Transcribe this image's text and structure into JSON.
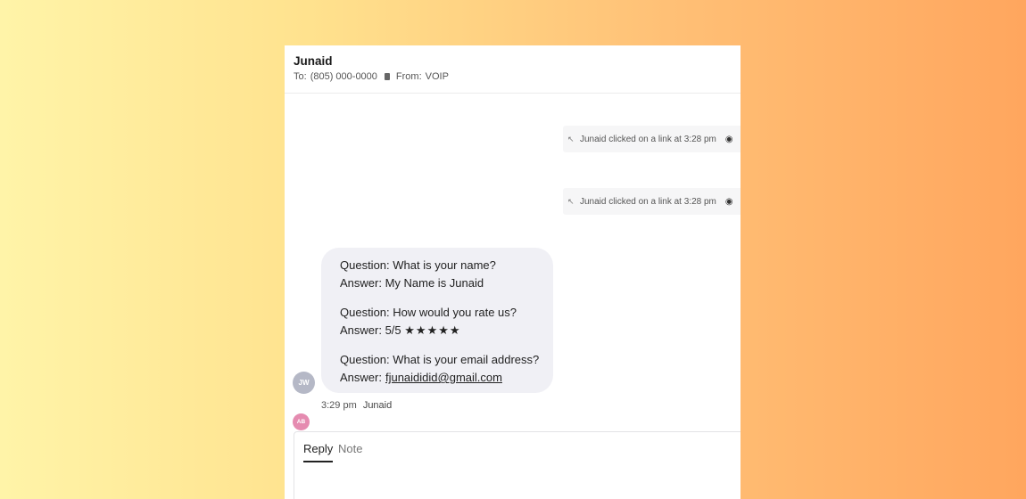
{
  "header": {
    "contact_name": "Junaid",
    "to_label": "To:",
    "to_number": "(805) 000-0000",
    "from_label": "From:",
    "from_value": "VOIP"
  },
  "events": [
    {
      "text": "Junaid clicked on a link at 3:28 pm",
      "icon": "cursor-click-icon",
      "status_icon": "eye-icon"
    },
    {
      "text": "Junaid clicked on a link at 3:28 pm",
      "icon": "cursor-click-icon",
      "status_icon": "eye-icon"
    }
  ],
  "message": {
    "qa": [
      {
        "question": "Question: What is your name?",
        "answer": "Answer: My Name is Junaid"
      },
      {
        "question": "Question: How would you rate us?",
        "answer_label": "Answer: 5/5",
        "stars": "★★★★★",
        "rating": 5
      },
      {
        "question": "Question: What is your email address?",
        "answer_label": "Answer:",
        "email": "fjunaididid@gmail.com"
      }
    ],
    "time": "3:29 pm",
    "sender": "Junaid",
    "avatar_initials": "JW"
  },
  "composer": {
    "avatar_initials": "AB",
    "tabs": [
      "Reply",
      "Note"
    ],
    "active_tab": "Reply"
  },
  "colors": {
    "bubble": "#f0f0f5",
    "avatar_jw": "#b5b8c6",
    "avatar_ab": "#e58bb0"
  }
}
